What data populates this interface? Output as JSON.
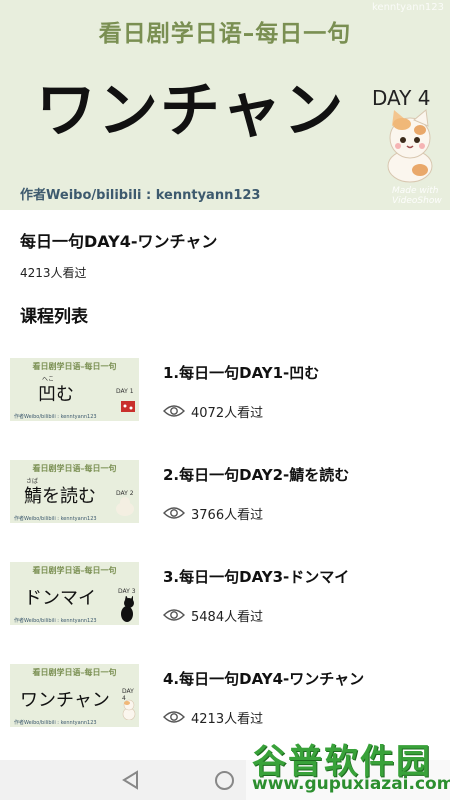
{
  "hero": {
    "title": "看日剧学日语–每日一句",
    "word": "ワンチャン",
    "day": "DAY 4",
    "author": "作者Weibo/bilibili : kenntyann123",
    "watermark": "kenntyann123",
    "made_with": "Made with VideoShow"
  },
  "current": {
    "title": "每日一句DAY4-ワンチャン",
    "views": "4213人看过"
  },
  "section_title": "课程列表",
  "courses": [
    {
      "name": "1.每日一句DAY1-凹む",
      "views": "4072人看过",
      "thumb_title": "看日剧学日语–每日一句",
      "thumb_word": "凹む",
      "thumb_ruby": "へこ",
      "thumb_day": "DAY 1",
      "thumb_author": "作者Weibo/bilibili : kenntyann123"
    },
    {
      "name": "2.每日一句DAY2-鯖を読む",
      "views": "3766人看过",
      "thumb_title": "看日剧学日语–每日一句",
      "thumb_word": "鯖を読む",
      "thumb_ruby": "さば",
      "thumb_day": "DAY 2",
      "thumb_author": "作者Weibo/bilibili : kenntyann123"
    },
    {
      "name": "3.每日一句DAY3-ドンマイ",
      "views": "5484人看过",
      "thumb_title": "看日剧学日语–每日一句",
      "thumb_word": "ドンマイ",
      "thumb_day": "DAY 3",
      "thumb_author": "作者Weibo/bilibili : kenntyann123"
    },
    {
      "name": "4.每日一句DAY4-ワンチャン",
      "views": "4213人看过",
      "thumb_title": "看日剧学日语–每日一句",
      "thumb_word": "ワンチャン",
      "thumb_day": "DAY 4",
      "thumb_author": "作者Weibo/bilibili : kenntyann123"
    }
  ],
  "watermark_logo": {
    "main": "谷普软件园",
    "url": "www.gupuxiazai.com"
  },
  "icons": {
    "views": "eye-icon",
    "nav_back": "back-triangle-icon",
    "nav_home": "home-circle-icon"
  },
  "colors": {
    "banner_bg": "#e8eedd",
    "banner_title": "#7a8f52",
    "logo_green": "#39a23a"
  }
}
